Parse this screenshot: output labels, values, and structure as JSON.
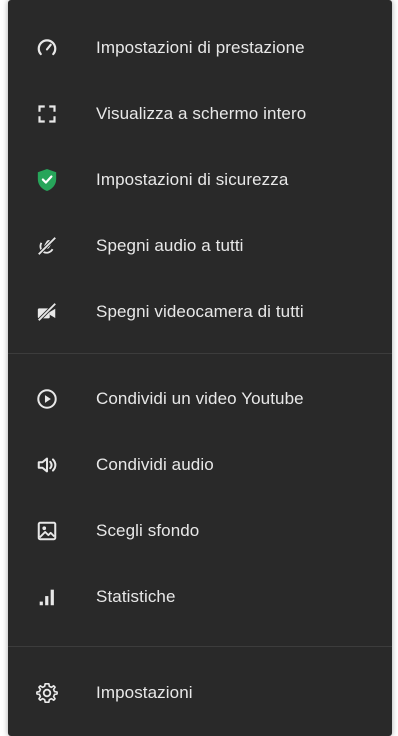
{
  "menu": {
    "group1": [
      {
        "label": "Impostazioni di prestazione",
        "icon": "gauge-icon"
      },
      {
        "label": "Visualizza a schermo intero",
        "icon": "fullscreen-icon"
      },
      {
        "label": "Impostazioni di sicurezza",
        "icon": "shield-icon"
      },
      {
        "label": "Spegni audio a tutti",
        "icon": "mic-off-icon"
      },
      {
        "label": "Spegni videocamera di tutti",
        "icon": "camera-off-icon"
      }
    ],
    "group2": [
      {
        "label": "Condividi un video Youtube",
        "icon": "play-circle-icon"
      },
      {
        "label": "Condividi audio",
        "icon": "speaker-icon"
      },
      {
        "label": "Scegli sfondo",
        "icon": "image-icon"
      },
      {
        "label": "Statistiche",
        "icon": "bar-chart-icon"
      }
    ],
    "group3": [
      {
        "label": "Impostazioni",
        "icon": "gear-icon"
      }
    ]
  },
  "colors": {
    "background": "#292929",
    "text": "#e8e8e8",
    "shield": "#27a55a",
    "divider": "#3c3c3c"
  }
}
